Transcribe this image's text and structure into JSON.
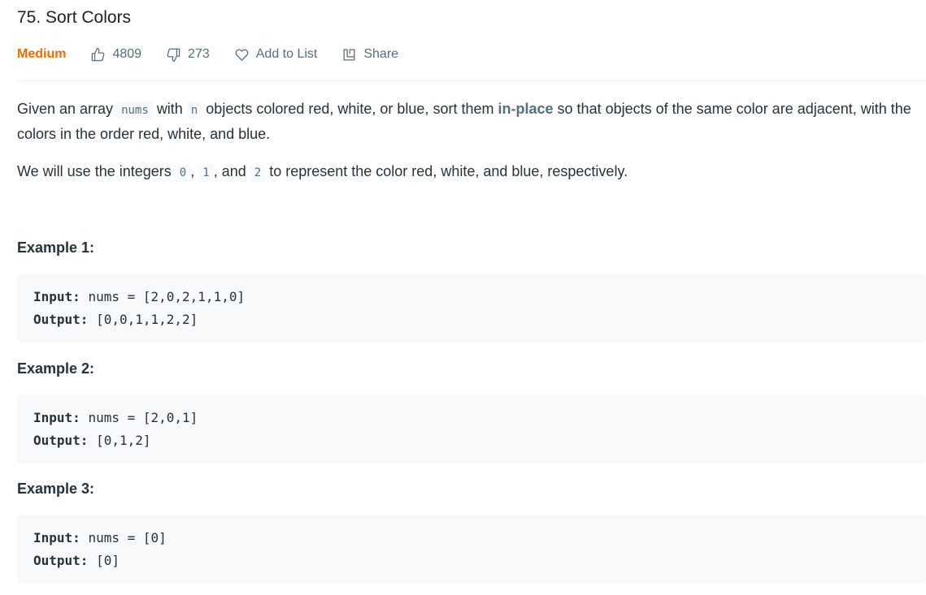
{
  "problem": {
    "title": "75. Sort Colors",
    "difficulty": "Medium",
    "likes": "4809",
    "dislikes": "273",
    "add_to_list": "Add to List",
    "share": "Share"
  },
  "description": {
    "p1_a": "Given an array",
    "p1_code1": "nums",
    "p1_b": "with",
    "p1_code2": "n",
    "p1_c": "objects colored red, white, or blue, sort them",
    "p1_strong": "in-place",
    "p1_d": "so that objects of the same color are adjacent, with the colors in the order red, white, and blue.",
    "p2_a": "We will use the integers",
    "p2_code1": "0",
    "p2_sep1": ",",
    "p2_code2": "1",
    "p2_sep2": ", and",
    "p2_code3": "2",
    "p2_b": "to represent the color red, white, and blue, respectively."
  },
  "examples": [
    {
      "heading": "Example 1:",
      "input_label": "Input:",
      "input": "nums = [2,0,2,1,1,0]",
      "output_label": "Output:",
      "output": "[0,0,1,1,2,2]"
    },
    {
      "heading": "Example 2:",
      "input_label": "Input:",
      "input": "nums = [2,0,1]",
      "output_label": "Output:",
      "output": "[0,1,2]"
    },
    {
      "heading": "Example 3:",
      "input_label": "Input:",
      "input": "nums = [0]",
      "output_label": "Output:",
      "output": "[0]"
    }
  ],
  "colors": {
    "difficulty": "#ef6c00",
    "text": "#263238",
    "muted": "#546e7a",
    "code_bg": "#f7f9fa"
  },
  "icons": [
    "thumbs-up-icon",
    "thumbs-down-icon",
    "heart-icon",
    "share-icon"
  ]
}
